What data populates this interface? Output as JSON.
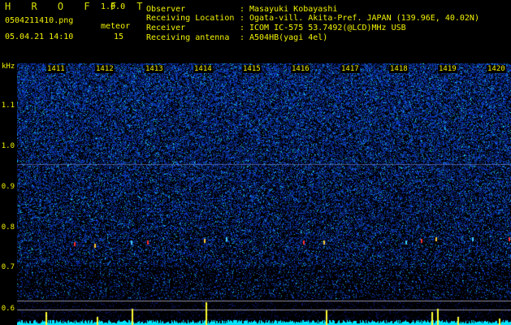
{
  "header": {
    "title": "H R O F F T",
    "version": "1.0.0",
    "filename": "0504211410.png",
    "datetime": "05.04.21 14:10",
    "meteor_label": "meteor",
    "meteor_count": "15"
  },
  "station": {
    "observer_label": "Observer",
    "observer_value": "Masayuki Kobayashi",
    "location_label": "Receiving Location",
    "location_value": "Ogata-vill. Akita-Pref. JAPAN (139.96E, 40.02N)",
    "receiver_label": "Receiver",
    "receiver_value": "ICOM IC-575 53.7492(@LCD)MHz USB",
    "antenna_label": "Receiving antenna",
    "antenna_value": "A504HB(yagi 4el)"
  },
  "spectrogram": {
    "y_unit": "kHz",
    "y_ticks": [
      "1.1",
      "1.0",
      "0.9",
      "0.8",
      "0.7",
      "0.6"
    ],
    "x_ticks": [
      "1411",
      "1412",
      "1413",
      "1414",
      "1415",
      "1416",
      "1417",
      "1418",
      "1419",
      "1420"
    ]
  },
  "colors": {
    "text": "#f2f200",
    "background": "#000000",
    "noise": "#1a3cb4",
    "baseline": "#00e6ff"
  }
}
